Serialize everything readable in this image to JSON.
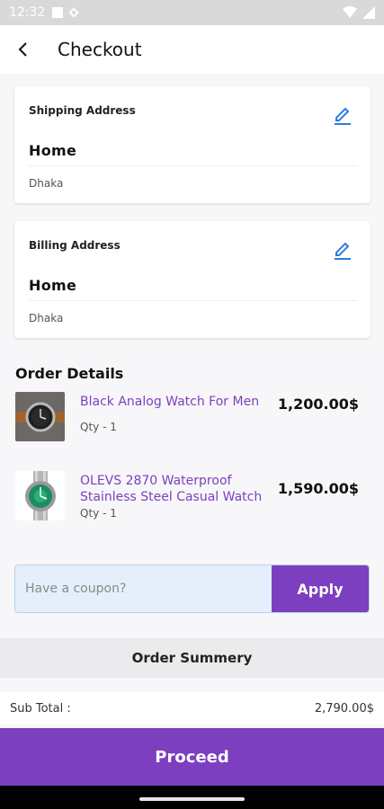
{
  "status_bar": {
    "time": "12:32"
  },
  "appbar": {
    "title": "Checkout"
  },
  "shipping": {
    "label": "Shipping Address",
    "name": "Home",
    "city": "Dhaka"
  },
  "billing": {
    "label": "Billing Address",
    "name": "Home",
    "city": "Dhaka"
  },
  "order": {
    "title": "Order Details",
    "items": [
      {
        "name": "Black Analog Watch For Men",
        "qty": "Qty -  1",
        "price": "1,200.00$"
      },
      {
        "name": "OLEVS 2870 Waterproof Stainless Steel Casual Watch",
        "qty": "Qty -  1",
        "price": "1,590.00$"
      }
    ]
  },
  "coupon": {
    "placeholder": "Have a coupon?",
    "apply_label": "Apply"
  },
  "summary": {
    "title": "Order Summery",
    "subtotal_label": "Sub Total :",
    "subtotal_value": "2,790.00$"
  },
  "proceed_label": "Proceed",
  "colors": {
    "accent": "#7b3fbf",
    "coupon_bg": "#e4effb",
    "edit_icon": "#2e7be0"
  }
}
